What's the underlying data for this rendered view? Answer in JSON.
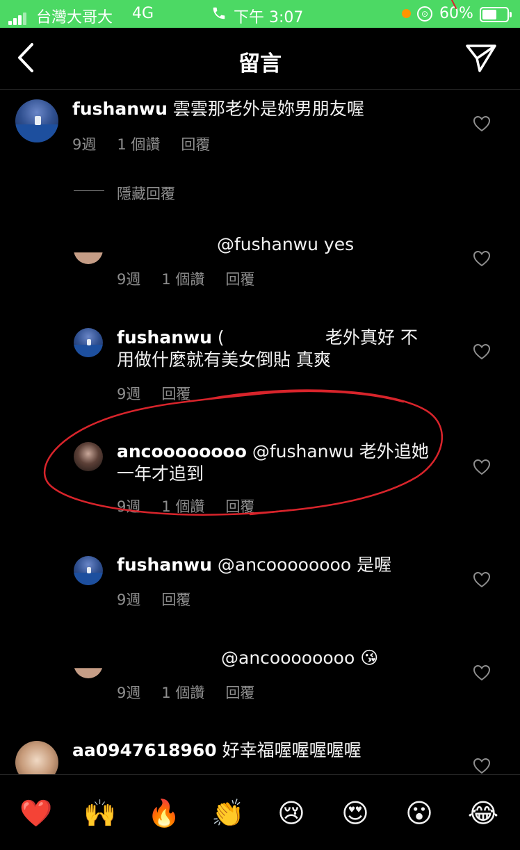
{
  "status_bar": {
    "carrier": "台灣大哥大",
    "network": "4G",
    "time": "下午 3:07",
    "battery": "60%"
  },
  "header": {
    "title": "留言"
  },
  "comments": [
    {
      "username": "fushanwu",
      "text": "雲雲那老外是妳男朋友喔",
      "age": "9週",
      "likes": "1 個讚",
      "reply": "回覆"
    },
    {
      "hide_replies": "隱藏回覆"
    },
    {
      "username": "",
      "text": "@fushanwu yes",
      "age": "9週",
      "likes": "1 個讚",
      "reply": "回覆"
    },
    {
      "username": "fushanwu",
      "text_line1": "(",
      "text_line1b": "老外真好 不",
      "text_line2": "用做什麼就有美女倒貼 真爽",
      "age": "9週",
      "reply": "回覆"
    },
    {
      "username": "ancoooooooo",
      "text_line1": "@fushanwu 老外追她",
      "text_line2": "一年才追到",
      "age": "9週",
      "likes": "1 個讚",
      "reply": "回覆"
    },
    {
      "username": "fushanwu",
      "text": "@ancoooooooo 是喔",
      "age": "9週",
      "reply": "回覆"
    },
    {
      "username": "",
      "text": "@ancoooooooo",
      "emoji": "😘",
      "age": "9週",
      "likes": "1 個讚",
      "reply": "回覆"
    },
    {
      "username": "aa0947618960",
      "text": "好幸福喔喔喔喔喔"
    }
  ],
  "emoji_bar": [
    "❤️",
    "🙌",
    "🔥",
    "👏",
    "😢",
    "😍",
    "😮",
    "😂"
  ],
  "colors": {
    "status_bar": "#4cd964",
    "background": "#000000",
    "annotation": "#d8242b"
  }
}
